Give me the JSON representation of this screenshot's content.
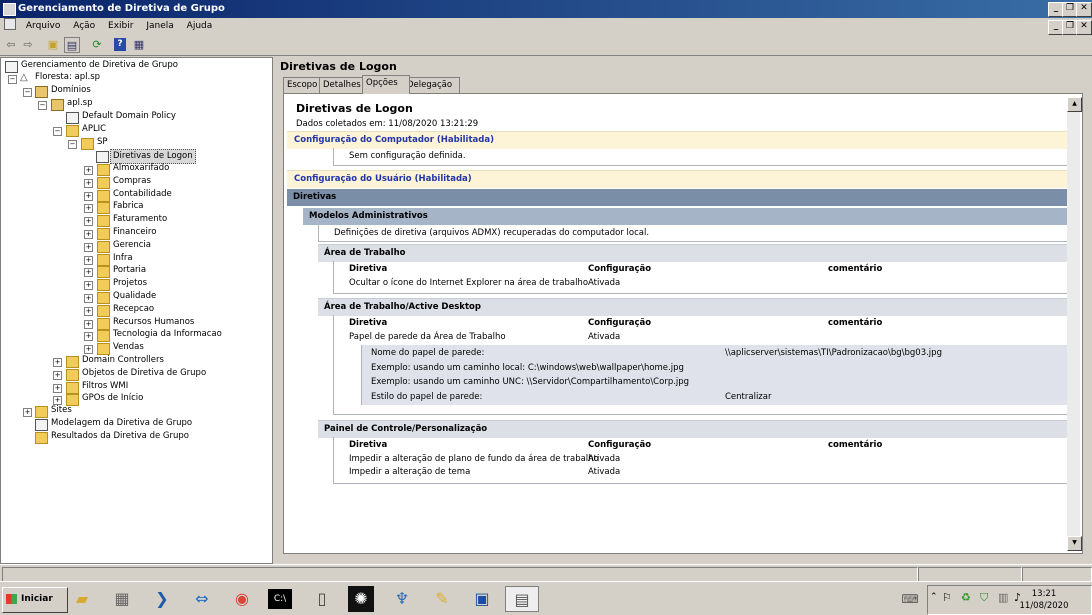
{
  "window": {
    "title": "Gerenciamento de Diretiva de Grupo",
    "caption_buttons": [
      "_",
      "❐",
      "✕"
    ]
  },
  "menu": {
    "items": [
      "Arquivo",
      "Ação",
      "Exibir",
      "Janela",
      "Ajuda"
    ]
  },
  "toolbar": {
    "icons": [
      "back-arrow-icon",
      "forward-arrow-icon",
      "up-folder-icon",
      "show-hide-tree-icon",
      "refresh-icon",
      "help-icon",
      "properties-icon"
    ]
  },
  "tree": {
    "root": "Gerenciamento de Diretiva de Grupo",
    "forest": "Floresta: apl.sp",
    "domains": "Domínios",
    "domain": "apl.sp",
    "default_policy": "Default Domain Policy",
    "aplic": "APLIC",
    "sp": "SP",
    "selected": "Diretivas de Logon",
    "sp_children": [
      "Almoxarifado",
      "Compras",
      "Contabilidade",
      "Fabrica",
      "Faturamento",
      "Financeiro",
      "Gerencia",
      "Infra",
      "Portaria",
      "Projetos",
      "Qualidade",
      "Recepcao",
      "Recursos Humanos",
      "Tecnologia da Informacao",
      "Vendas"
    ],
    "domain_children": [
      "Domain Controllers",
      "Objetos de Diretiva de Grupo",
      "Filtros WMI",
      "GPOs de Início"
    ],
    "sites": "Sites",
    "modeling": "Modelagem da Diretiva de Grupo",
    "results": "Resultados da Diretiva de Grupo"
  },
  "right": {
    "title": "Diretivas de Logon",
    "tabs": [
      "Escopo",
      "Detalhes",
      "Opções",
      "Delegação"
    ],
    "active_tab": "Opções"
  },
  "report": {
    "title": "Diretivas de Logon",
    "collected": "Dados coletados em: 11/08/2020 13:21:29",
    "computer_section": "Configuração do Computador (Habilitada)",
    "computer_none": "Sem configuração definida.",
    "user_section": "Configuração do Usuário (Habilitada)",
    "policies": "Diretivas",
    "admin_templates": "Modelos Administrativos",
    "admx_note": "Definições de diretiva (arquivos ADMX) recuperadas do computador local.",
    "col_policy": "Diretiva",
    "col_setting": "Configuração",
    "col_comment": "comentário",
    "desktop": {
      "title": "Área de Trabalho",
      "rows": [
        {
          "policy": "Ocultar o ícone do Internet Explorer na área de trabalho",
          "setting": "Ativada"
        }
      ]
    },
    "active_desktop": {
      "title": "Área de Trabalho/Active Desktop",
      "rows": [
        {
          "policy": "Papel de parede da Área de Trabalho",
          "setting": "Ativada"
        }
      ],
      "details": [
        {
          "label": "Nome do papel de parede:",
          "value": "\\\\aplicserver\\sistemas\\TI\\Padronizacao\\bg\\bg03.jpg"
        },
        {
          "label": "Exemplo: usando um caminho local: C:\\windows\\web\\wallpaper\\home.jpg",
          "value": ""
        },
        {
          "label": "Exemplo: usando um caminho UNC: \\\\Servidor\\Compartilhamento\\Corp.jpg",
          "value": ""
        },
        {
          "label": "Estilo do papel de parede:",
          "value": "Centralizar"
        }
      ]
    },
    "control_panel": {
      "title": "Painel de Controle/Personalização",
      "rows": [
        {
          "policy": "Impedir a alteração de plano de fundo da área de trabalho",
          "setting": "Ativada"
        },
        {
          "policy": "Impedir a alteração de tema",
          "setting": "Ativada"
        }
      ]
    }
  },
  "taskbar": {
    "start_label": "Iniciar",
    "apps": [
      "file-explorer-icon",
      "server-manager-icon",
      "powershell-icon",
      "teamviewer-icon",
      "chrome-icon",
      "command-prompt-icon",
      "device-icon",
      "aperture-icon",
      "network-icon",
      "pencil-icon",
      "remote-desktop-icon",
      "gpmc-icon"
    ],
    "clock_time": "13:21",
    "clock_date": "11/08/2020"
  },
  "colors": {
    "title_bar": "#0a246a",
    "section_yellow": "#fdf3d6",
    "section_text_blue": "#2236a8",
    "dark_blue_bar": "#7a8ea8",
    "mid_blue_bar": "#a6b4c8"
  }
}
